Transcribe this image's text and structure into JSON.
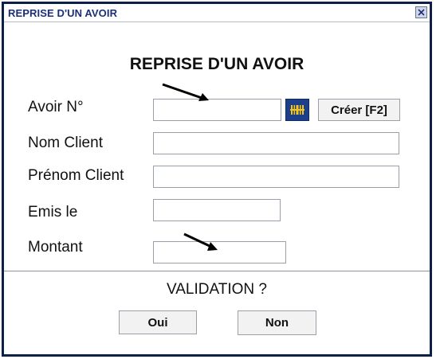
{
  "window": {
    "title": "REPRISE D'UN AVOIR",
    "close_icon": "close-icon"
  },
  "form": {
    "heading": "REPRISE D'UN AVOIR",
    "fields": {
      "avoir_no": {
        "label": "Avoir N°",
        "value": ""
      },
      "nom_client": {
        "label": "Nom Client",
        "value": ""
      },
      "prenom_client": {
        "label": "Prénom Client",
        "value": ""
      },
      "emis_le": {
        "label": "Emis le",
        "value": ""
      },
      "montant": {
        "label": "Montant",
        "value": ""
      }
    },
    "barcode_icon": "barcode-icon",
    "create_button": "Créer [F2]"
  },
  "validation": {
    "question": "VALIDATION ?",
    "yes": "Oui",
    "no": "Non"
  },
  "colors": {
    "title_text": "#1b2f7a",
    "frame": "#0d2147",
    "icon_button_bg": "#1d3f8a",
    "icon_glyph": "#f5c518"
  }
}
